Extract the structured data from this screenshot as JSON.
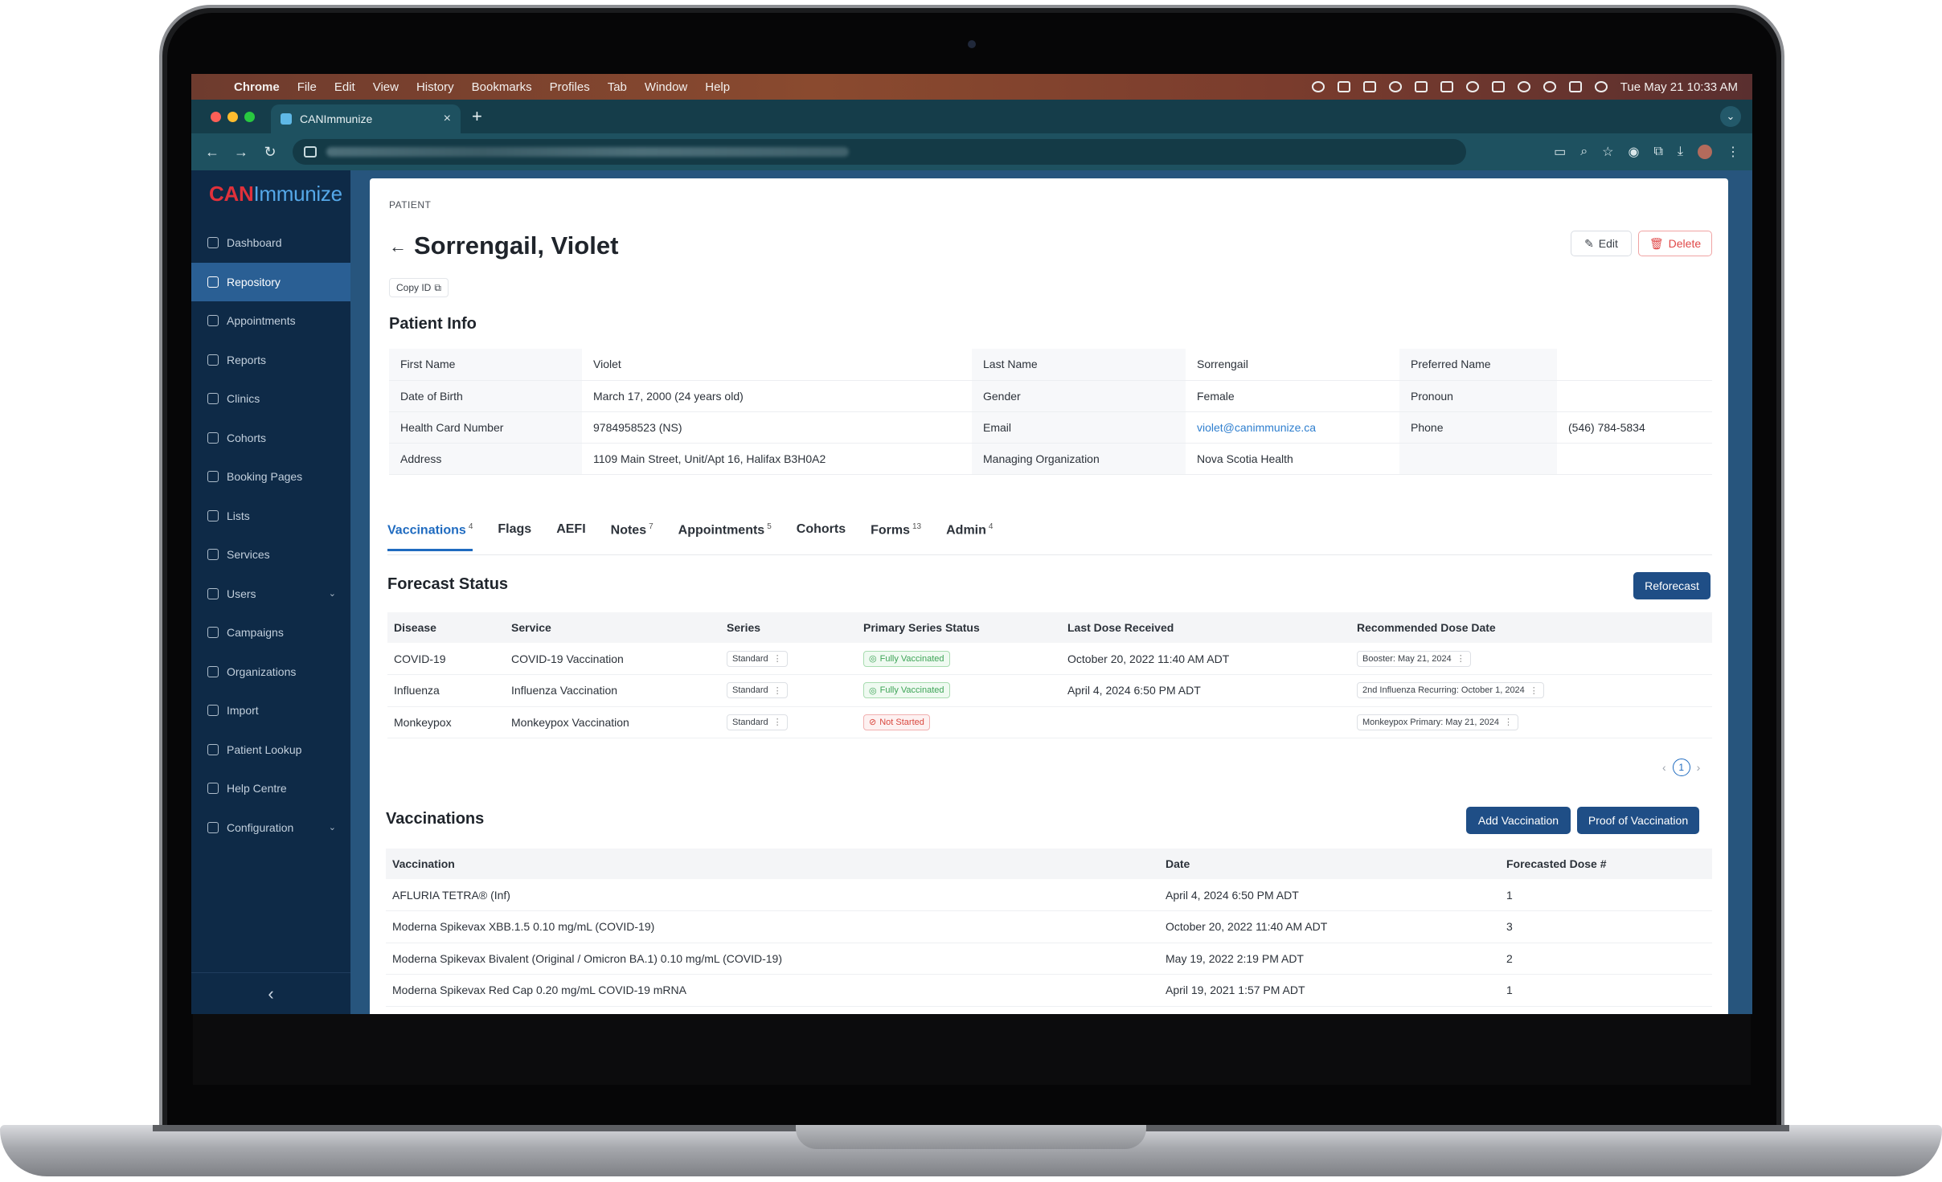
{
  "menubar": {
    "apple": "",
    "app_name": "Chrome",
    "items": [
      "File",
      "Edit",
      "View",
      "History",
      "Bookmarks",
      "Profiles",
      "Tab",
      "Window",
      "Help"
    ],
    "clock": "Tue May 21  10:33 AM"
  },
  "browser": {
    "tab_title": "CANImmunize",
    "tab_close": "×",
    "new_tab": "+",
    "back": "←",
    "forward": "→",
    "reload": "↻"
  },
  "sidebar": {
    "logo_can": "CAN",
    "logo_immunize": "Immunize",
    "items": [
      {
        "label": "Dashboard",
        "icon": "home-icon"
      },
      {
        "label": "Repository",
        "icon": "repository-icon",
        "active": true
      },
      {
        "label": "Appointments",
        "icon": "calendar-icon"
      },
      {
        "label": "Reports",
        "icon": "reports-icon"
      },
      {
        "label": "Clinics",
        "icon": "clinic-icon"
      },
      {
        "label": "Cohorts",
        "icon": "cohorts-icon"
      },
      {
        "label": "Booking Pages",
        "icon": "booking-icon"
      },
      {
        "label": "Lists",
        "icon": "lists-icon"
      },
      {
        "label": "Services",
        "icon": "services-icon"
      },
      {
        "label": "Users",
        "icon": "user-icon",
        "expandable": true
      },
      {
        "label": "Campaigns",
        "icon": "campaign-icon"
      },
      {
        "label": "Organizations",
        "icon": "organization-icon"
      },
      {
        "label": "Import",
        "icon": "import-icon"
      },
      {
        "label": "Patient Lookup",
        "icon": "search-icon"
      },
      {
        "label": "Help Centre",
        "icon": "help-icon"
      },
      {
        "label": "Configuration",
        "icon": "configuration-icon",
        "expandable": true
      }
    ],
    "chevron": "⌄",
    "collapse": "‹"
  },
  "patient": {
    "breadcrumb": "PATIENT",
    "back": "←",
    "name": "Sorrengail, Violet",
    "edit_label": "Edit",
    "delete_label": "Delete",
    "copy_id_label": "Copy ID"
  },
  "patient_info": {
    "title": "Patient Info",
    "rows": [
      [
        "First Name",
        "Violet",
        "Last Name",
        "Sorrengail",
        "Preferred Name",
        ""
      ],
      [
        "Date of Birth",
        "March 17, 2000 (24 years old)",
        "Gender",
        "Female",
        "Pronoun",
        ""
      ],
      [
        "Health Card Number",
        "9784958523 (NS)",
        "Email",
        "violet@canimmunize.ca",
        "Phone",
        "(546) 784-5834"
      ],
      [
        "Address",
        "1109 Main Street, Unit/Apt 16, Halifax B3H0A2",
        "Managing Organization",
        "Nova Scotia Health",
        "",
        ""
      ]
    ]
  },
  "tabs": [
    {
      "label": "Vaccinations",
      "count": "4",
      "active": true
    },
    {
      "label": "Flags",
      "count": ""
    },
    {
      "label": "AEFI",
      "count": ""
    },
    {
      "label": "Notes",
      "count": "7"
    },
    {
      "label": "Appointments",
      "count": "5"
    },
    {
      "label": "Cohorts",
      "count": ""
    },
    {
      "label": "Forms",
      "count": "13"
    },
    {
      "label": "Admin",
      "count": "4"
    }
  ],
  "forecast": {
    "title": "Forecast Status",
    "reforecast_label": "Reforecast",
    "headers": [
      "Disease",
      "Service",
      "Series",
      "Primary Series Status",
      "Last Dose Received",
      "Recommended Dose Date"
    ],
    "rows": [
      {
        "disease": "COVID-19",
        "service": "COVID-19 Vaccination",
        "series": "Standard",
        "status": "Fully Vaccinated",
        "status_type": "green",
        "last_dose": "October 20, 2022 11:40 AM ADT",
        "recommended": "Booster: May 21, 2024"
      },
      {
        "disease": "Influenza",
        "service": "Influenza Vaccination",
        "series": "Standard",
        "status": "Fully Vaccinated",
        "status_type": "green",
        "last_dose": "April 4, 2024 6:50 PM ADT",
        "recommended": "2nd Influenza Recurring: October 1, 2024"
      },
      {
        "disease": "Monkeypox",
        "service": "Monkeypox Vaccination",
        "series": "Standard",
        "status": "Not Started",
        "status_type": "red",
        "last_dose": "",
        "recommended": "Monkeypox Primary: May 21, 2024"
      }
    ],
    "page": "1"
  },
  "vaccinations": {
    "title": "Vaccinations",
    "add_label": "Add Vaccination",
    "proof_label": "Proof of Vaccination",
    "headers": [
      "Vaccination",
      "Date",
      "Forecasted Dose #"
    ],
    "rows": [
      [
        "AFLURIA TETRA® (Inf)",
        "April 4, 2024 6:50 PM ADT",
        "1"
      ],
      [
        "Moderna Spikevax XBB.1.5 0.10 mg/mL (COVID-19)",
        "October 20, 2022 11:40 AM ADT",
        "3"
      ],
      [
        "Moderna Spikevax Bivalent (Original / Omicron BA.1) 0.10 mg/mL (COVID-19)",
        "May 19, 2022 2:19 PM ADT",
        "2"
      ],
      [
        "Moderna Spikevax Red Cap 0.20 mg/mL COVID-19 mRNA",
        "April 19, 2021 1:57 PM ADT",
        "1"
      ]
    ]
  },
  "colors": {
    "accent": "#1f6bc0",
    "sidebar_bg": "#0e2a47",
    "sidebar_active": "#2a5f94",
    "primary_button": "#1f4e86",
    "danger": "#e04848",
    "success": "#3ea457"
  }
}
